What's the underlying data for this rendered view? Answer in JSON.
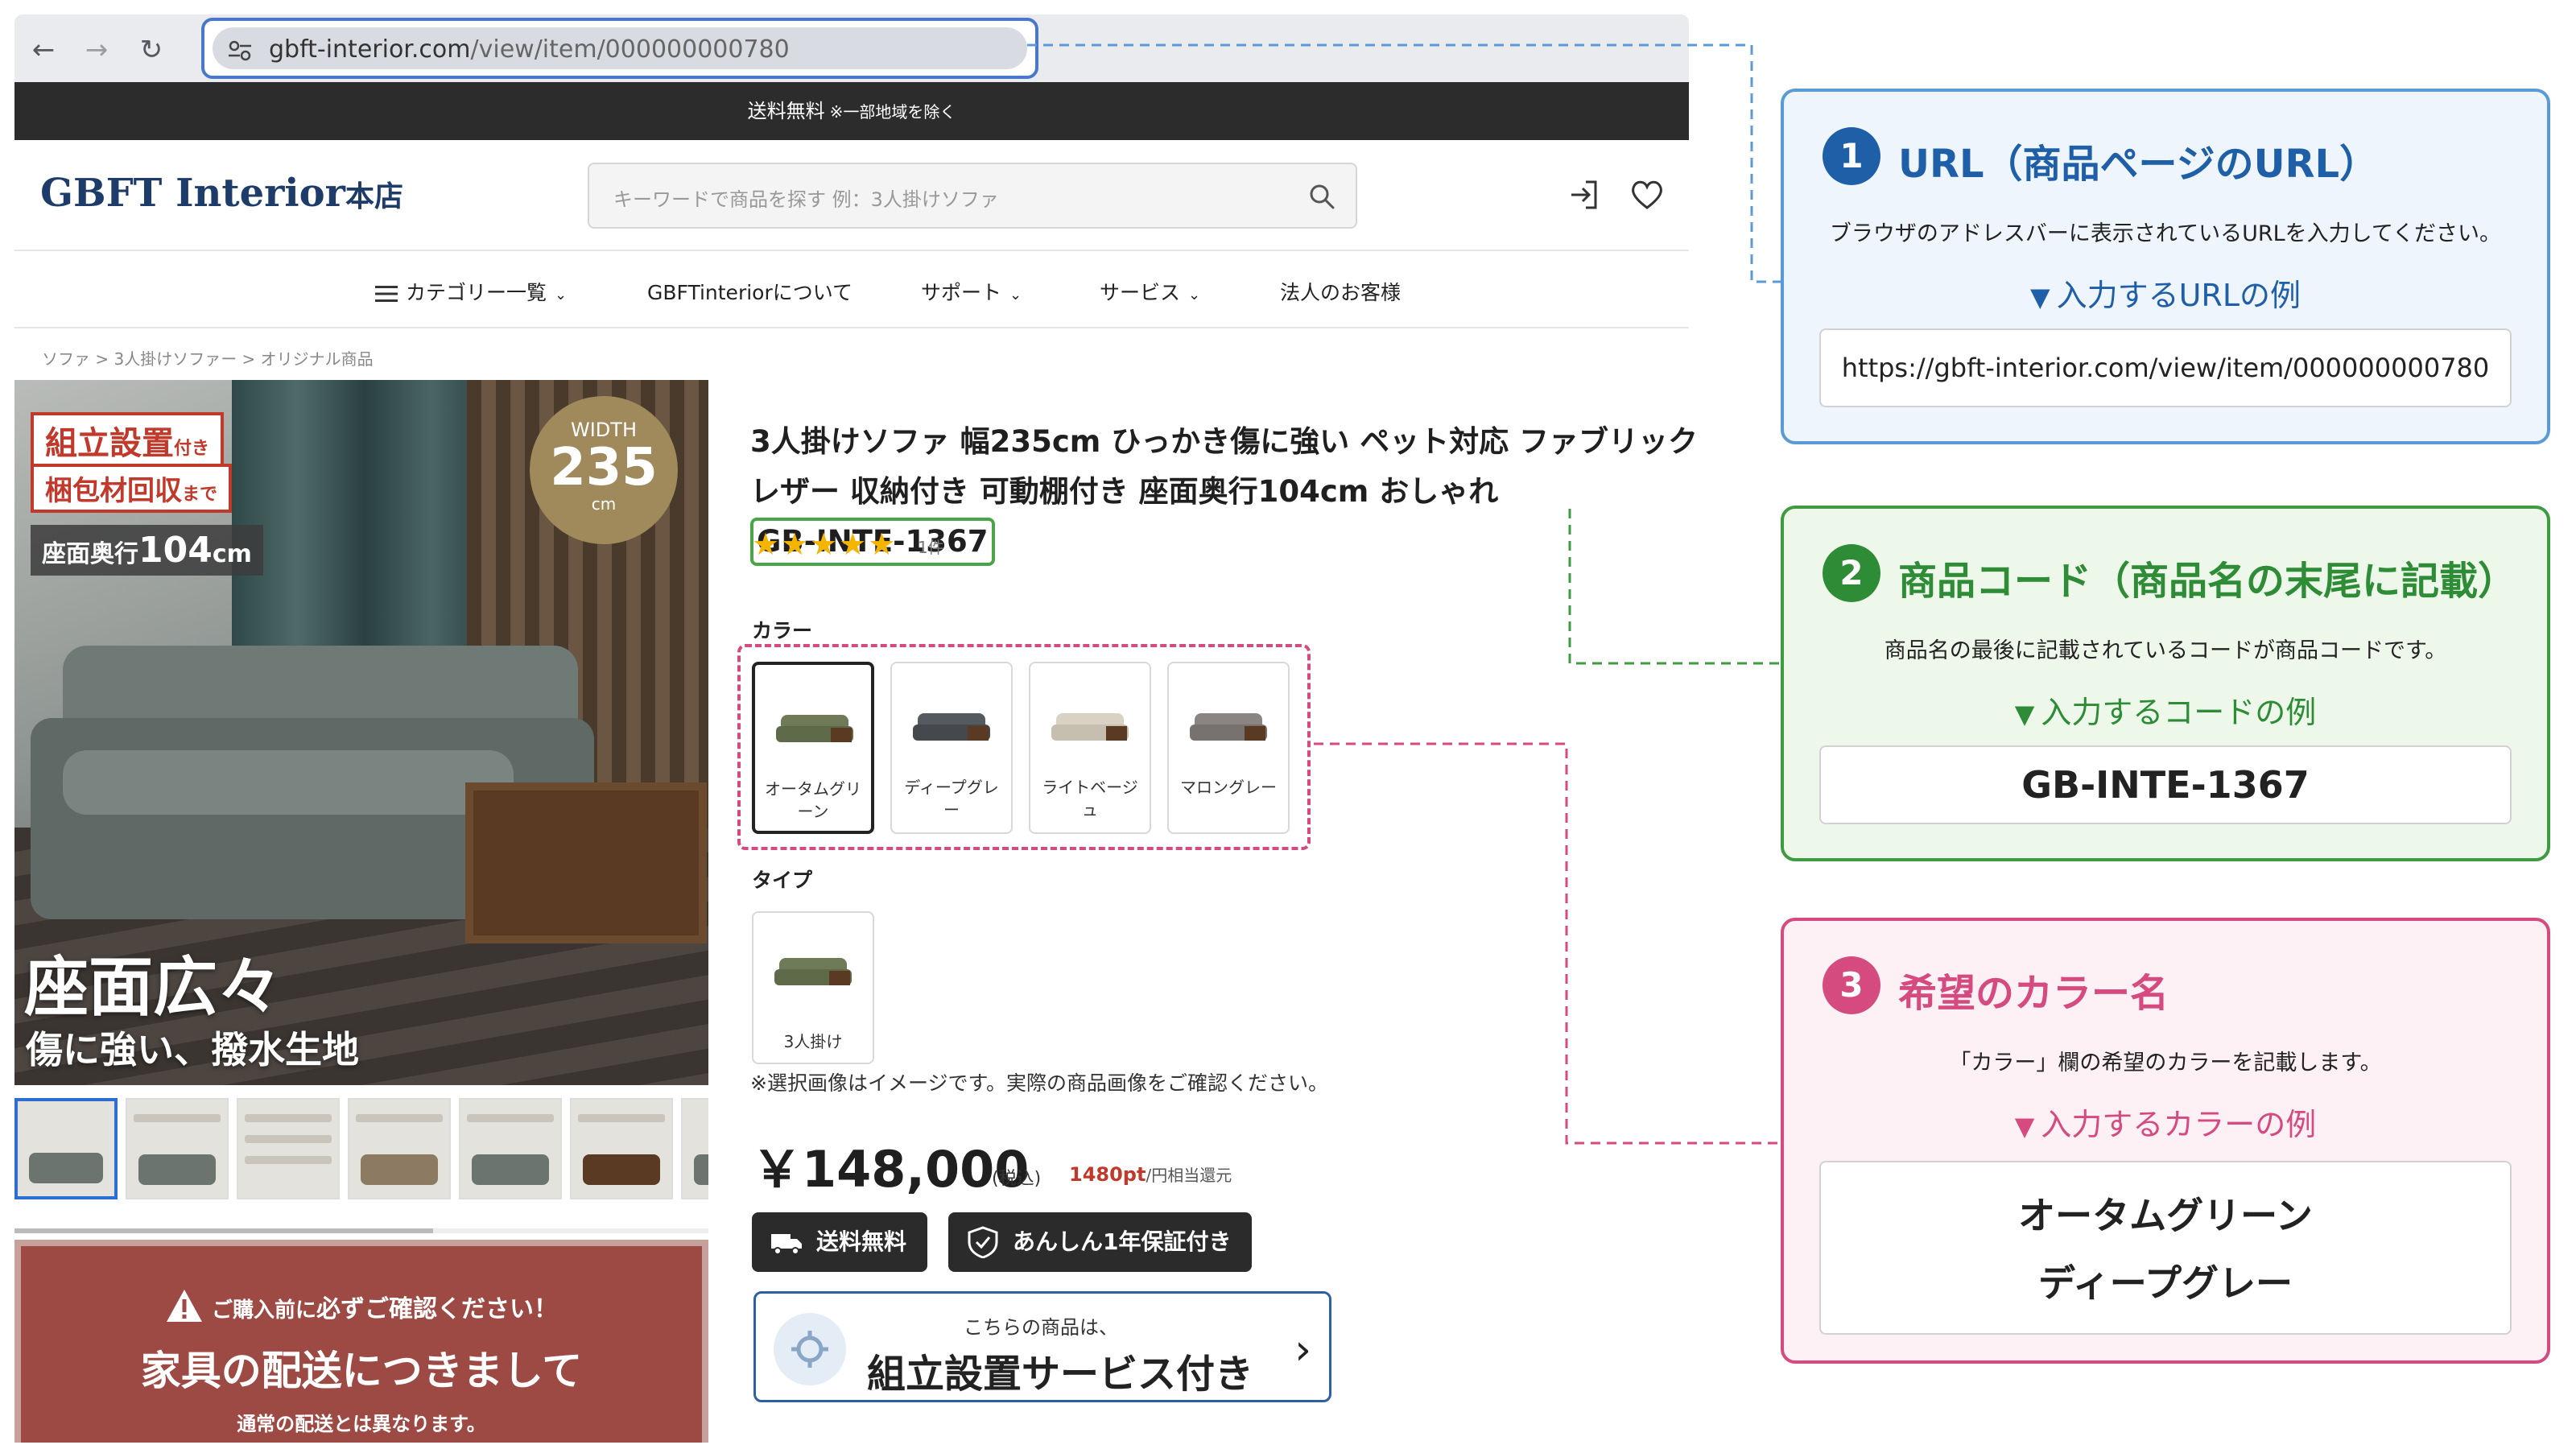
{
  "browser": {
    "url_domain": "gbft-interior.com",
    "url_path": "/view/item/000000000780"
  },
  "site": {
    "shipping_bar": "送料無料",
    "shipping_bar_note": "※一部地域を除く",
    "logo_main": "GBFT Interior",
    "logo_suffix": "本店",
    "search_placeholder": "キーワードで商品を探す 例：3人掛けソファ",
    "nav": {
      "category": "カテゴリー一覧",
      "about": "GBFTinteriorについて",
      "support": "サポート",
      "service": "サービス",
      "corporate": "法人のお客様"
    },
    "breadcrumb": "ソファ > 3人掛けソファー > オリジナル商品"
  },
  "gallery": {
    "badge1_main": "組立設置",
    "badge1_small": "付き",
    "badge2_main": "梱包材回収",
    "badge2_small": "まで",
    "depth_prefix": "座面奥行",
    "depth_value": "104",
    "depth_unit": "cm",
    "width_label": "WIDTH",
    "width_value": "235",
    "width_unit": "cm",
    "headline": "座面広々",
    "subline": "傷に強い、撥水生地",
    "thumb_count": 7
  },
  "notice": {
    "line1_pre": "ご購入前に",
    "line1_emph": "必ずご確認ください！",
    "line2": "家具の配送につきまして",
    "line3": "通常の配送とは異なります。"
  },
  "product": {
    "title": "3人掛けソファ 幅235cm ひっかき傷に強い ペット対応 ファブリックレザー 収納付き 可動棚付き 座面奥行104cm おしゃれ",
    "code": "GB-INTE-1367",
    "rating": 5,
    "stars": "★★★★★",
    "review_count": "1件",
    "color_label": "カラー",
    "colors": [
      {
        "name": "オータムグリーン",
        "swatch": "#6e7a58",
        "selected": true
      },
      {
        "name": "ディープグレー",
        "swatch": "#555a5e",
        "selected": false
      },
      {
        "name": "ライトベージュ",
        "swatch": "#d9d2c4",
        "selected": false
      },
      {
        "name": "マロングレー",
        "swatch": "#8a8583",
        "selected": false
      }
    ],
    "type_label": "タイプ",
    "type_name": "3人掛け",
    "note": "※選択画像はイメージです。実際の商品画像をご確認ください。",
    "price": "￥148,000",
    "tax": "(税込)",
    "points": "1480pt",
    "points_note": "/円相当還元",
    "tag_shipping": "送料無料",
    "tag_warranty": "あんしん1年保証付き",
    "service_sub": "こちらの商品は、",
    "service_main": "組立設置サービス付き"
  },
  "annotations": [
    {
      "num": "1",
      "head": "URL（商品ページのURL）",
      "desc": "ブラウザのアドレスバーに表示されているURLを入力してください。",
      "example_label": "入力するURLの例",
      "example_value": "https://gbft-interior.com/view/item/000000000780",
      "color": "#1f5fa8"
    },
    {
      "num": "2",
      "head": "商品コード（商品名の末尾に記載）",
      "desc": "商品名の最後に記載されているコードが商品コードです。",
      "example_label": "入力するコードの例",
      "example_value": "GB-INTE-1367",
      "color": "#2e8b36"
    },
    {
      "num": "3",
      "head": "希望のカラー名",
      "desc": "「カラー」欄の希望のカラーを記載します。",
      "example_label": "入力するカラーの例",
      "example_value_1": "オータムグリーン",
      "example_value_2": "ディープグレー",
      "color": "#d54a7f"
    }
  ],
  "triangle": "▼"
}
